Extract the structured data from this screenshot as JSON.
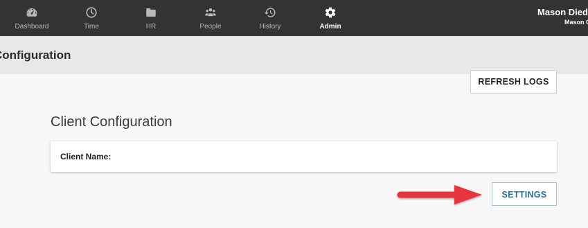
{
  "nav": {
    "items": [
      {
        "label": "Dashboard",
        "icon": "dashboard-gauge-icon",
        "active": false
      },
      {
        "label": "Time",
        "icon": "clock-icon",
        "active": false
      },
      {
        "label": "HR",
        "icon": "folder-icon",
        "active": false
      },
      {
        "label": "People",
        "icon": "people-group-icon",
        "active": false
      },
      {
        "label": "History",
        "icon": "history-icon",
        "active": false
      },
      {
        "label": "Admin",
        "icon": "gear-icon",
        "active": true
      }
    ],
    "user": {
      "name": "Mason Died",
      "sub": "Mason C"
    }
  },
  "header": {
    "title": "Configuration"
  },
  "actions": {
    "refresh_logs_label": "REFRESH LOGS",
    "settings_label": "SETTINGS"
  },
  "client_config": {
    "section_title": "Client Configuration",
    "client_name_label": "Client Name:"
  },
  "annotation": {
    "arrow_color": "#e8363c",
    "points_to": "settings-button"
  },
  "colors": {
    "topbar": "#333333",
    "header_band": "#e8e8e8",
    "settings_text": "#2d6f9a"
  }
}
